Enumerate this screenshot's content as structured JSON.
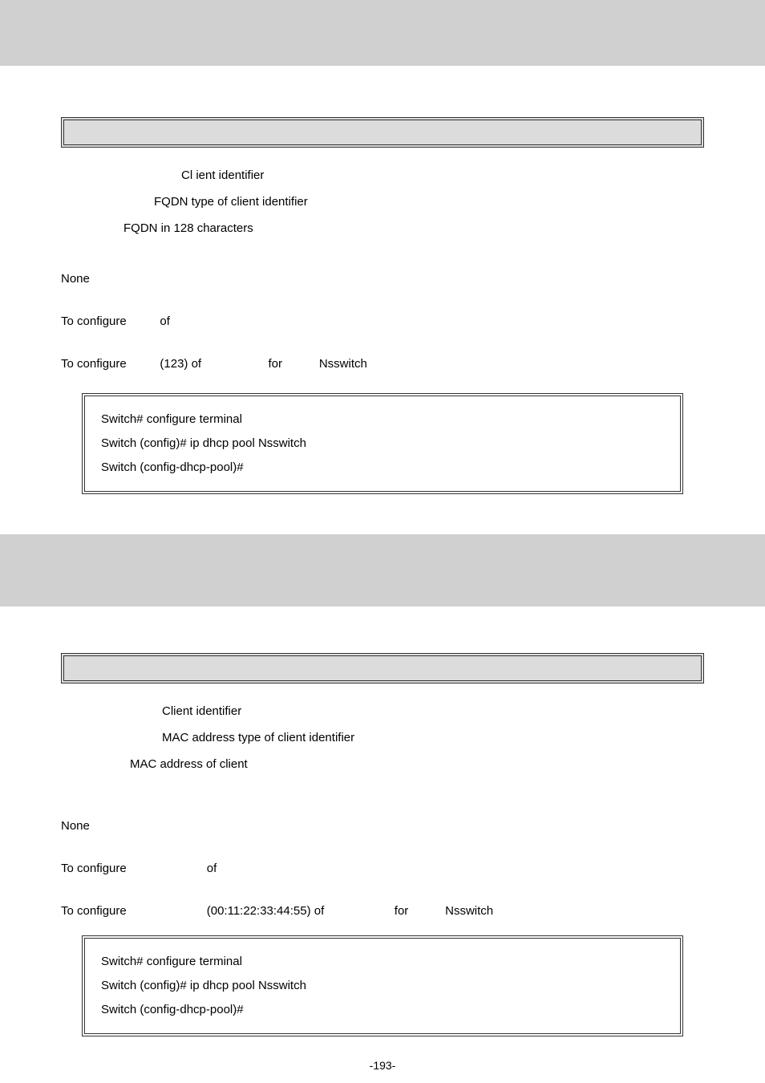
{
  "section1": {
    "params": [
      {
        "lead": "",
        "desc": "Cl ient identifier"
      },
      {
        "lead": "",
        "desc": "FQDN type of client identifier"
      },
      {
        "lead": "",
        "desc": "FQDN in 128 characters"
      }
    ],
    "default": "None",
    "mode_parts": [
      "To configure",
      "",
      "of",
      ""
    ],
    "example_parts": [
      "To configure",
      "",
      "(123) of",
      "",
      "for",
      "",
      "Nsswitch"
    ],
    "code": [
      "Switch# configure terminal",
      "Switch (config)# ip dhcp pool Nsswitch",
      "Switch (config-dhcp-pool)#"
    ]
  },
  "section2": {
    "params": [
      {
        "lead": "",
        "desc": "Client identifier"
      },
      {
        "lead": "",
        "desc": "MAC address type of client identifier"
      },
      {
        "lead": "",
        "desc": "MAC address of client"
      }
    ],
    "default": "None",
    "mode_parts": [
      "To configure",
      "",
      "of",
      ""
    ],
    "example_parts": [
      "To configure",
      "",
      "(00:11:22:33:44:55) of",
      "",
      "for",
      "",
      "Nsswitch"
    ],
    "code": [
      "Switch# configure terminal",
      "Switch (config)# ip dhcp pool Nsswitch",
      "Switch (config-dhcp-pool)#"
    ]
  },
  "pagefoot": "-193-"
}
